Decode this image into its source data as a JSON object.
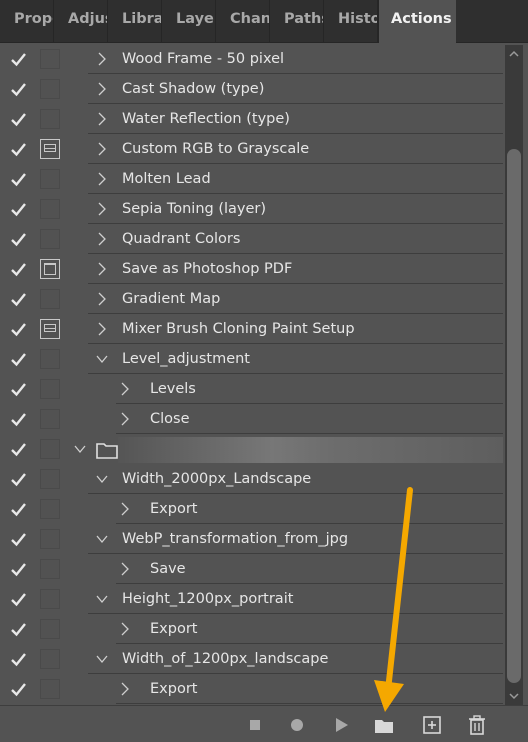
{
  "tabs": [
    {
      "label": "Prope",
      "active": false
    },
    {
      "label": "Adjus",
      "active": false
    },
    {
      "label": "Librar",
      "active": false
    },
    {
      "label": "Layers",
      "active": false
    },
    {
      "label": "Chann",
      "active": false
    },
    {
      "label": "Paths",
      "active": false
    },
    {
      "label": "Histor",
      "active": false
    },
    {
      "label": "Actions",
      "active": true
    }
  ],
  "actions": [
    {
      "label": "Wood Frame - 50 pixel",
      "level": 1,
      "expanded": false,
      "dialog": "none"
    },
    {
      "label": "Cast Shadow (type)",
      "level": 1,
      "expanded": false,
      "dialog": "none"
    },
    {
      "label": "Water Reflection (type)",
      "level": 1,
      "expanded": false,
      "dialog": "none"
    },
    {
      "label": "Custom RGB to Grayscale",
      "level": 1,
      "expanded": false,
      "dialog": "partial"
    },
    {
      "label": "Molten Lead",
      "level": 1,
      "expanded": false,
      "dialog": "none"
    },
    {
      "label": "Sepia Toning (layer)",
      "level": 1,
      "expanded": false,
      "dialog": "none"
    },
    {
      "label": "Quadrant Colors",
      "level": 1,
      "expanded": false,
      "dialog": "none"
    },
    {
      "label": "Save as Photoshop PDF",
      "level": 1,
      "expanded": false,
      "dialog": "full"
    },
    {
      "label": "Gradient Map",
      "level": 1,
      "expanded": false,
      "dialog": "none"
    },
    {
      "label": "Mixer Brush Cloning Paint Setup",
      "level": 1,
      "expanded": false,
      "dialog": "partial"
    },
    {
      "label": "Level_adjustment",
      "level": 1,
      "expanded": true,
      "dialog": "none"
    },
    {
      "label": "Levels",
      "level": 2,
      "expanded": false,
      "dialog": "none"
    },
    {
      "label": "Close",
      "level": 2,
      "expanded": false,
      "dialog": "none"
    },
    {
      "label": "",
      "level": 0,
      "expanded": true,
      "dialog": "none",
      "is_set": true
    },
    {
      "label": "Width_2000px_Landscape",
      "level": 1,
      "expanded": true,
      "dialog": "none"
    },
    {
      "label": "Export",
      "level": 2,
      "expanded": false,
      "dialog": "none"
    },
    {
      "label": "WebP_transformation_from_jpg",
      "level": 1,
      "expanded": true,
      "dialog": "none"
    },
    {
      "label": "Save",
      "level": 2,
      "expanded": false,
      "dialog": "none"
    },
    {
      "label": "Height_1200px_portrait",
      "level": 1,
      "expanded": true,
      "dialog": "none"
    },
    {
      "label": "Export",
      "level": 2,
      "expanded": false,
      "dialog": "none"
    },
    {
      "label": "Width_of_1200px_landscape",
      "level": 1,
      "expanded": true,
      "dialog": "none"
    },
    {
      "label": "Export",
      "level": 2,
      "expanded": false,
      "dialog": "none"
    }
  ],
  "footer": {
    "buttons": [
      "stop-icon",
      "record-icon",
      "play-icon",
      "folder-icon",
      "new-action-icon",
      "trash-icon"
    ]
  },
  "colors": {
    "panel": "#535353",
    "tabbar": "#2f2f2f",
    "text": "#e6e6e6",
    "annotation_arrow": "#f5a800"
  }
}
